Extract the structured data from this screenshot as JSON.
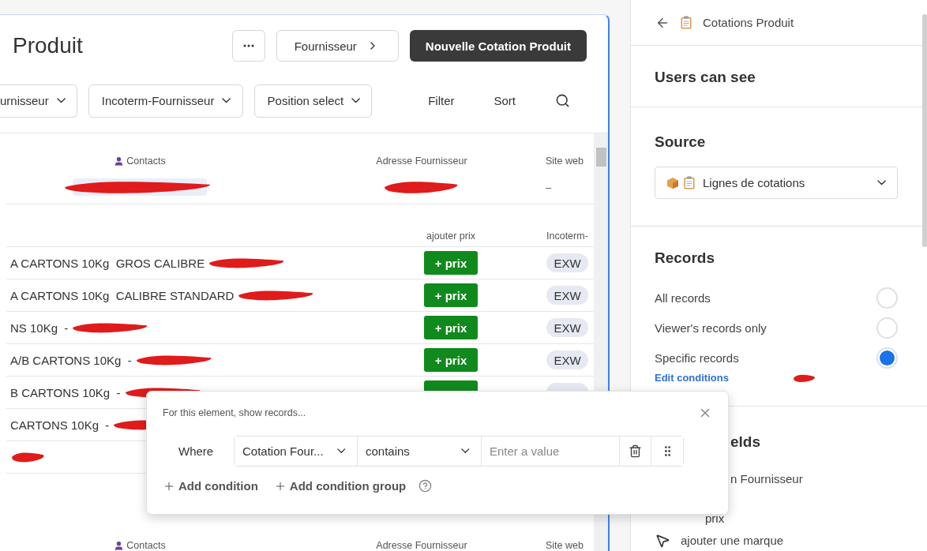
{
  "header": {
    "title": "Produit",
    "supplier_button": "Fournisseur",
    "primary_button": "Nouvelle Cotation Produit"
  },
  "filters": [
    {
      "label": "urnisseur"
    },
    {
      "label": "Incoterm-Fournisseur"
    },
    {
      "label": "Position select"
    }
  ],
  "actions": [
    "Filter",
    "Sort"
  ],
  "supplier_card": {
    "columns": [
      "Contacts",
      "Adresse Fournisseur",
      "Site web"
    ],
    "values": [
      {
        "redacted": true
      },
      {
        "redacted": true
      },
      {
        "text": "–",
        "redacted": false
      }
    ]
  },
  "lines": {
    "columns": [
      "ajouter prix",
      "Incoterm-"
    ],
    "rows": [
      {
        "label": "A CARTONS 10Kg  GROS CALIBRE",
        "redacted": true,
        "action": "+ prix",
        "incoterm": "EXW"
      },
      {
        "label": "A CARTONS 10Kg  CALIBRE STANDARD",
        "redacted": true,
        "action": "+ prix",
        "incoterm": "EXW"
      },
      {
        "label": "NS 10Kg  -",
        "redacted": true,
        "action": "+ prix",
        "incoterm": "EXW"
      },
      {
        "label": "A/B CARTONS 10Kg  -",
        "redacted": true,
        "action": "+ prix",
        "incoterm": "EXW"
      },
      {
        "label": "B CARTONS 10Kg  -",
        "redacted": true,
        "controls_covered": true
      },
      {
        "label": "CARTONS 10Kg  -",
        "redacted": true
      },
      {
        "redacted": true
      }
    ]
  },
  "next_card": {
    "columns": [
      "Contacts",
      "Adresse Fournisseur",
      "Site web"
    ]
  },
  "popup": {
    "description": "For this element, show records...",
    "where": "Where",
    "field": "Cotation Four...",
    "operator": "contains",
    "value_placeholder": "Enter a value",
    "add_buttons": [
      "Add condition",
      "Add condition group"
    ]
  },
  "panel": {
    "breadcrumb": "Cotations Produit",
    "heading": "Users can see",
    "source": {
      "label": "Source",
      "value": "Lignes de cotations"
    },
    "records": {
      "label": "Records",
      "options": [
        {
          "label": "All records",
          "selected": false
        },
        {
          "label": "Viewer's records only",
          "selected": false
        },
        {
          "label": "Specific records",
          "selected": true
        }
      ],
      "link": "Edit conditions",
      "scribble": true
    },
    "fields": {
      "heading": "elds",
      "items": [
        {
          "label": "n Fournisseur",
          "kind": "clipped"
        },
        {
          "label": "prix",
          "kind": "offset"
        },
        {
          "label": "ajouter une marque",
          "kind": "cursor"
        }
      ]
    }
  }
}
